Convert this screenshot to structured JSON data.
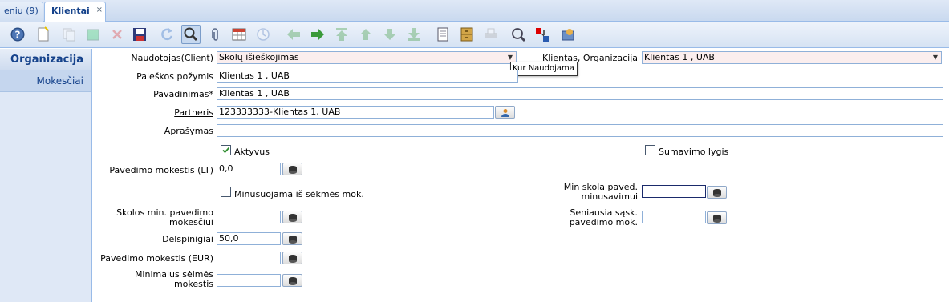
{
  "tabs": [
    {
      "label": "eniu (9)"
    },
    {
      "label": "Klientai",
      "close": "×"
    }
  ],
  "toolbar": {
    "icons": [
      "help-icon",
      "new-record-icon",
      "copy-record-icon",
      "delete-all-icon",
      "delete-icon",
      "save-icon",
      "refresh-icon",
      "find-icon",
      "attachment-icon",
      "grid-toggle-icon",
      "history-icon",
      "back-icon",
      "forward-icon",
      "first-record-icon",
      "previous-record-icon",
      "next-record-icon",
      "last-record-icon",
      "report-icon",
      "archive-icon",
      "print-icon",
      "zoom-across-icon",
      "workflow-icon",
      "request-icon"
    ]
  },
  "leftnav": {
    "header": "Organizacija",
    "items": [
      {
        "label": "Mokesčiai"
      }
    ]
  },
  "form": {
    "client_label": "Naudotojas(Client)",
    "client_value": "Skolų išieškojimas",
    "org_label": "Klientas, Organizacija",
    "org_value": "Klientas 1 , UAB",
    "search_label": "Paieškos požymis",
    "search_value": "Klientas 1 , UAB",
    "name_label": "Pavadinimas*",
    "name_value": "Klientas 1 , UAB",
    "partner_label": "Partneris",
    "partner_value": "123333333-Klientas 1, UAB",
    "desc_label": "Aprašymas",
    "desc_value": "",
    "active_label": "Aktyvus",
    "active_checked": true,
    "summary_label": "Sumavimo lygis",
    "summary_checked": false,
    "fee_lt_label": "Pavedimo mokestis (LT)",
    "fee_lt_value": "0,0",
    "deduct_label": "Minusuojama iš sėkmės mok.",
    "deduct_checked": false,
    "min_debt_label_1": "Min skola paved.",
    "min_debt_label_2": "minusavimui",
    "min_debt_value": "",
    "min_fee_label_1": "Skolos min. pavedimo",
    "min_fee_label_2": "mokesčiui",
    "min_fee_value": "",
    "oldest_label_1": "Seniausia sąsk.",
    "oldest_label_2": "pavedimo mok.",
    "oldest_value": "",
    "penalty_label": "Delspinigiai",
    "penalty_value": "50,0",
    "fee_eur_label": "Pavedimo mokestis (EUR)",
    "fee_eur_value": "",
    "min_success_label_1": "Minimalus sėlmės",
    "min_success_label_2": "mokestis",
    "min_success_value": ""
  },
  "tooltip": "Kur Naudojama"
}
